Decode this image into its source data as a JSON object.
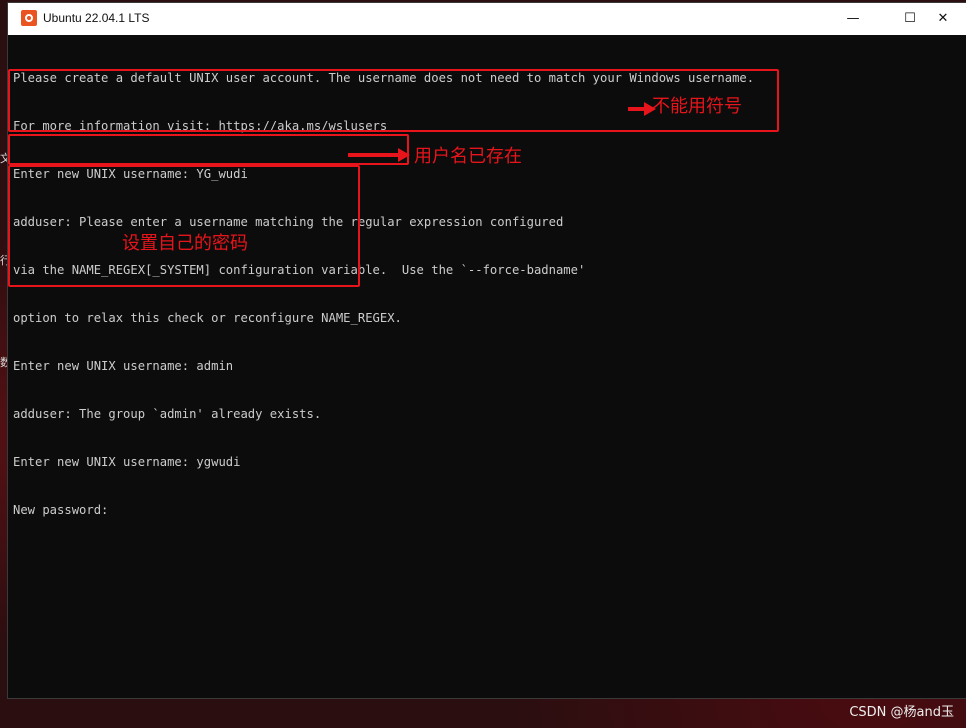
{
  "window": {
    "title": "Ubuntu 22.04.1 LTS",
    "icon": "ubuntu-icon",
    "controls": {
      "minimize": "—",
      "maximize": "☐",
      "close": "✕"
    }
  },
  "terminal": {
    "lines": [
      "Please create a default UNIX user account. The username does not need to match your Windows username.",
      "For more information visit: https://aka.ms/wslusers",
      "Enter new UNIX username: YG_wudi",
      "adduser: Please enter a username matching the regular expression configured",
      "via the NAME_REGEX[_SYSTEM] configuration variable.  Use the `--force-badname'",
      "option to relax this check or reconfigure NAME_REGEX.",
      "Enter new UNIX username: admin",
      "adduser: The group `admin' already exists.",
      "Enter new UNIX username: ygwudi",
      "New password:"
    ]
  },
  "annotations": {
    "no_symbols": "不能用符号",
    "username_exists": "用户名已存在",
    "set_password": "设置自己的密码"
  },
  "side_glyphs": {
    "a": "文",
    "b": "行",
    "c": "数"
  },
  "watermark": "CSDN @杨and玉",
  "colors": {
    "annotation_red": "#e8141b",
    "terminal_bg": "#0c0c0c",
    "terminal_text": "#cccccc",
    "ubuntu_orange": "#e95420"
  }
}
